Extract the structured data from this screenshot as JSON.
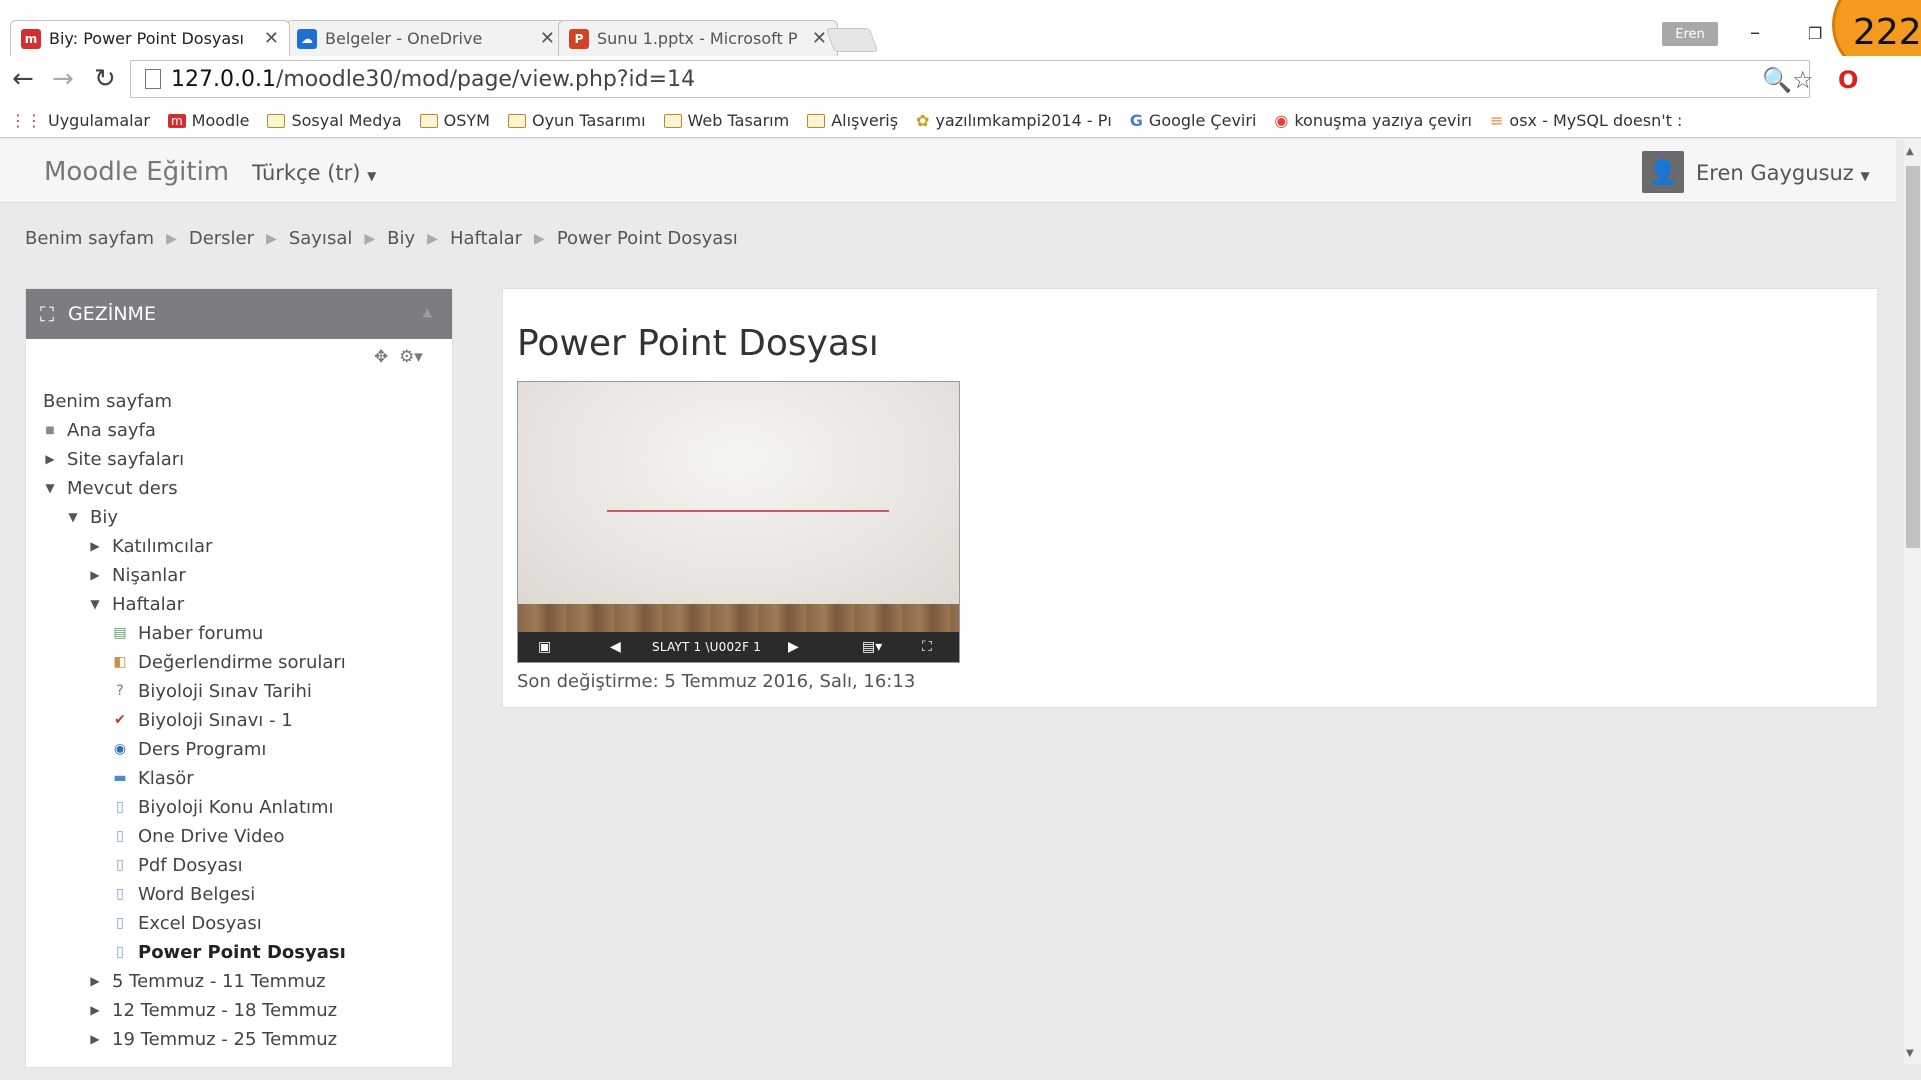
{
  "browser": {
    "tabs": [
      {
        "title": "Biy: Power Point Dosyası",
        "active": true,
        "icon": "moodle-icon",
        "color": "#d32f2f"
      },
      {
        "title": "Belgeler - OneDrive",
        "active": false,
        "icon": "onedrive-icon",
        "color": "#1e6fd0"
      },
      {
        "title": "Sunu 1.pptx - Microsoft P",
        "active": false,
        "icon": "powerpoint-icon",
        "color": "#d04423"
      }
    ],
    "tab_close": "✕",
    "profile_name": "Eren",
    "badge_number": "222",
    "url_host": "127.0.0.1",
    "url_path": "/moodle30/mod/page/view.php?id=14",
    "bookmarks": [
      {
        "label": "Uygulamalar",
        "icon": "apps-grid-icon"
      },
      {
        "label": "Moodle",
        "icon": "moodle-icon"
      },
      {
        "label": "Sosyal Medya",
        "icon": "folder-icon"
      },
      {
        "label": "OSYM",
        "icon": "folder-icon"
      },
      {
        "label": "Oyun Tasarımı",
        "icon": "folder-icon"
      },
      {
        "label": "Web Tasarım",
        "icon": "folder-icon"
      },
      {
        "label": "Alışveriş",
        "icon": "folder-icon"
      },
      {
        "label": "yazılımkampi2014 - Pı",
        "icon": "site-icon"
      },
      {
        "label": "Google Çeviri",
        "icon": "translate-icon"
      },
      {
        "label": "konuşma yazıya çevirı",
        "icon": "chrome-icon"
      },
      {
        "label": "osx - MySQL doesn't :",
        "icon": "stackoverflow-icon"
      }
    ]
  },
  "navbar": {
    "brand": "Moodle Eğitim",
    "language": "Türkçe (tr)",
    "user": "Eren Gaygusuz"
  },
  "breadcrumb": [
    "Benim sayfam",
    "Dersler",
    "Sayısal",
    "Biy",
    "Haftalar",
    "Power Point Dosyası"
  ],
  "navigation_block": {
    "title": "GEZİNME",
    "tree": {
      "root": "Benim sayfam",
      "home": "Ana sayfa",
      "site_pages": "Site sayfaları",
      "current_course": "Mevcut ders",
      "course": "Biy",
      "participants": "Katılımcılar",
      "badges": "Nişanlar",
      "weeks": "Haftalar",
      "activities": [
        {
          "label": "Haber forumu",
          "icon": "forum-icon",
          "color": "#5aa864"
        },
        {
          "label": "Değerlendirme soruları",
          "icon": "feedback-icon",
          "color": "#d08a4a"
        },
        {
          "label": "Biyoloji Sınav Tarihi",
          "icon": "choice-icon",
          "color": "#4a7fc1"
        },
        {
          "label": "Biyoloji Sınavı - 1",
          "icon": "quiz-icon",
          "color": "#c0392b"
        },
        {
          "label": "Ders Programı",
          "icon": "url-icon",
          "color": "#2d6fb4"
        },
        {
          "label": "Klasör",
          "icon": "folder-icon",
          "color": "#4a8ad4"
        },
        {
          "label": "Biyoloji Konu Anlatımı",
          "icon": "page-icon",
          "color": "#7a9cc6"
        },
        {
          "label": "One Drive Video",
          "icon": "page-icon",
          "color": "#7a9cc6"
        },
        {
          "label": "Pdf Dosyası",
          "icon": "page-icon",
          "color": "#7a9cc6"
        },
        {
          "label": "Word Belgesi",
          "icon": "page-icon",
          "color": "#7a9cc6"
        },
        {
          "label": "Excel Dosyası",
          "icon": "page-icon",
          "color": "#7a9cc6"
        },
        {
          "label": "Power Point Dosyası",
          "icon": "page-icon",
          "color": "#7a9cc6",
          "current": true
        }
      ],
      "week_sections": [
        "5 Temmuz - 11 Temmuz",
        "12 Temmuz - 18 Temmuz",
        "19 Temmuz - 25 Temmuz"
      ]
    }
  },
  "main": {
    "title": "Power Point Dosyası",
    "embed": {
      "slide_label": "SLAYT 1 \\U002F 1"
    },
    "last_modified": "Son değiştirme: 5 Temmuz 2016, Salı, 16:13"
  },
  "colors": {
    "block_header": "#7b7d80",
    "accent_badge": "#f39a1f"
  }
}
